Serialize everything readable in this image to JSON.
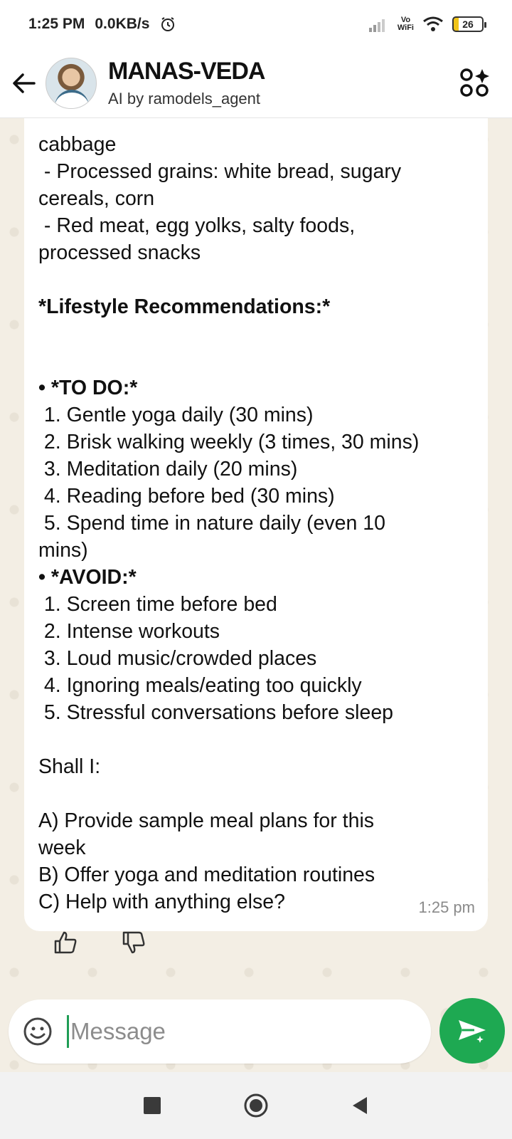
{
  "status_bar": {
    "time": "1:25 PM",
    "net_speed": "0.0KB/s",
    "vowifi_top": "Vo",
    "vowifi_bottom": "WiFi",
    "battery": "26"
  },
  "header": {
    "title": "MANAS-VEDA",
    "subtitle": "AI by ramodels_agent"
  },
  "message": {
    "lines": [
      "cabbage",
      " - Processed grains: white bread, sugary",
      "cereals, corn",
      " - Red meat, egg yolks, salty foods,",
      "processed snacks"
    ],
    "lifestyle_heading": "*Lifestyle Recommendations:*",
    "todo_heading": "• *TO DO:*",
    "todo_items": [
      " 1. Gentle yoga daily (30 mins)",
      " 2. Brisk walking weekly (3 times, 30 mins)",
      " 3. Meditation daily (20 mins)",
      " 4. Reading before bed (30 mins)",
      " 5. Spend time in nature daily (even 10",
      "mins)"
    ],
    "avoid_heading": "• *AVOID:*",
    "avoid_items": [
      " 1. Screen time before bed",
      " 2. Intense workouts",
      " 3. Loud music/crowded places",
      " 4. Ignoring meals/eating too quickly",
      " 5. Stressful conversations before sleep"
    ],
    "question": "Shall I:",
    "options": [
      "A) Provide sample meal plans for this",
      "week",
      "B) Offer yoga and meditation routines",
      "C) Help with anything else?"
    ],
    "timestamp": "1:25 pm"
  },
  "composer": {
    "placeholder": "Message"
  },
  "icons": {
    "back": "arrow-left-icon",
    "menu": "apps-sparkle-icon",
    "like": "thumbs-up-icon",
    "dislike": "thumbs-down-icon",
    "emoji": "smiley-icon",
    "send": "send-sparkle-icon",
    "accent_color": "#1ea952"
  }
}
